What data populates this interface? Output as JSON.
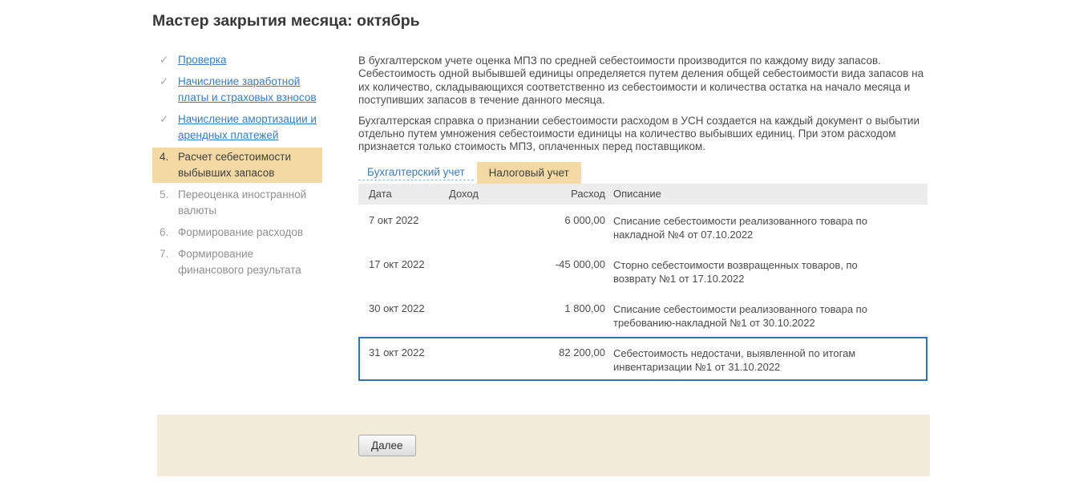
{
  "page": {
    "title": "Мастер закрытия месяца: октябрь"
  },
  "sidebar": {
    "items": [
      {
        "marker": "✓",
        "label": "Проверка",
        "state": "done",
        "interactable": "true"
      },
      {
        "marker": "✓",
        "label": "Начисление заработной платы и страховых взносов",
        "state": "done",
        "interactable": "true"
      },
      {
        "marker": "✓",
        "label": "Начисление амортизации и арендных платежей",
        "state": "done",
        "interactable": "true"
      },
      {
        "marker": "4.",
        "label": "Расчет себестоимости выбывших запасов",
        "state": "active",
        "interactable": "false"
      },
      {
        "marker": "5.",
        "label": "Переоценка иностранной валюты",
        "state": "pending",
        "interactable": "false"
      },
      {
        "marker": "6.",
        "label": "Формирование расходов",
        "state": "pending",
        "interactable": "false"
      },
      {
        "marker": "7.",
        "label": "Формирование финансового результата",
        "state": "pending",
        "interactable": "false"
      }
    ]
  },
  "content": {
    "paragraph1": "В бухгалтерском учете оценка МПЗ по средней себестоимости производится по каждому виду запасов. Себестоимость одной выбывшей единицы определяется путем деления общей себестоимости вида запасов на их количество, складывающихся соответственно из себестоимости и количества остатка на начало месяца и поступивших запасов в течение данного месяца.",
    "paragraph2": "Бухгалтерская справка о признании себестоимости расходом в УСН создается на каждый документ о выбытии отдельно путем умножения себестоимости единицы на количество выбывших единиц. При этом расходом признается только стоимость МПЗ, оплаченных перед поставщиком."
  },
  "tabs": [
    {
      "label": "Бухгалтерский учет",
      "state": "link",
      "interactable": "true"
    },
    {
      "label": "Налоговый учет",
      "state": "active",
      "interactable": "true"
    }
  ],
  "table": {
    "headers": [
      "Дата",
      "Доход",
      "Расход",
      "Описание"
    ],
    "rows": [
      {
        "date": "7 окт 2022",
        "income": "",
        "expense": "6 000,00",
        "description": "Списание себестоимости реализованного товара по накладной №4 от 07.10.2022",
        "state": "normal"
      },
      {
        "date": "17 окт 2022",
        "income": "",
        "expense": "-45 000,00",
        "description": "Сторно себестоимости возвращенных товаров, по возврату №1 от 17.10.2022",
        "state": "normal"
      },
      {
        "date": "30 окт 2022",
        "income": "",
        "expense": "1 800,00",
        "description": "Списание себестоимости реализованного товара по требованию-накладной №1 от 30.10.2022",
        "state": "normal"
      },
      {
        "date": "31 окт 2022",
        "income": "",
        "expense": "82 200,00",
        "description": "Себестоимость недостачи, выявленной по итогам инвентаризации №1 от 31.10.2022",
        "state": "selected"
      }
    ]
  },
  "footer": {
    "next_button": "Далее"
  },
  "colors": {
    "accent_tan": "#f3d9a3",
    "link_blue": "#3c7cbc",
    "selected_border": "#2e74b5",
    "footer_bg": "#f2ebda",
    "header_bg": "#ececec"
  }
}
